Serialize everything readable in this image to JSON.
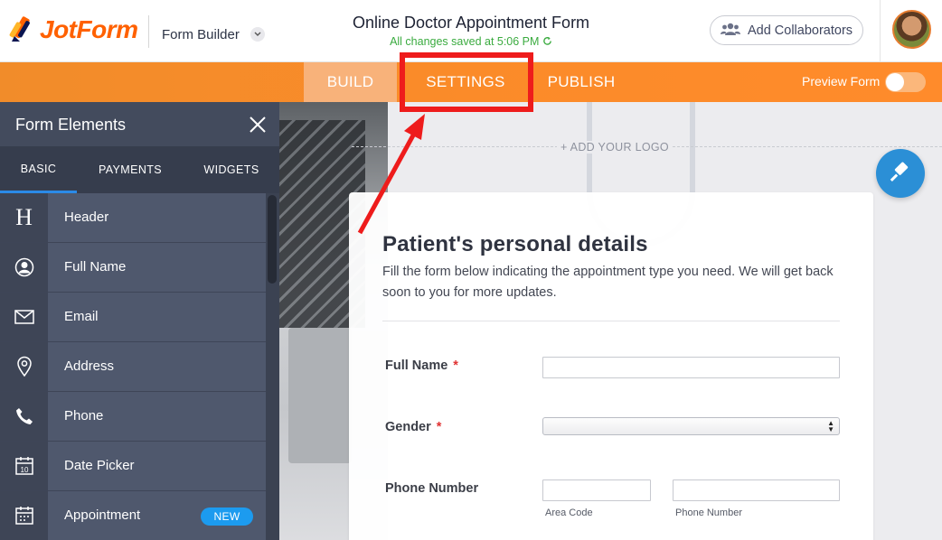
{
  "header": {
    "logo_text": "JotForm",
    "builder_label": "Form Builder",
    "form_title": "Online Doctor Appointment Form",
    "saved_status": "All changes saved at 5:06 PM",
    "collaborators_button": "Add Collaborators"
  },
  "nav": {
    "tabs": [
      "BUILD",
      "SETTINGS",
      "PUBLISH"
    ],
    "active_tab": "BUILD",
    "highlighted_tab": "SETTINGS",
    "preview_label": "Preview Form",
    "preview_toggle_on": false
  },
  "sidebar": {
    "title": "Form Elements",
    "tabs": [
      "BASIC",
      "PAYMENTS",
      "WIDGETS"
    ],
    "active_tab": "BASIC",
    "items": [
      {
        "label": "Header",
        "icon": "header-icon"
      },
      {
        "label": "Full Name",
        "icon": "user-icon"
      },
      {
        "label": "Email",
        "icon": "envelope-icon"
      },
      {
        "label": "Address",
        "icon": "map-pin-icon"
      },
      {
        "label": "Phone",
        "icon": "phone-icon"
      },
      {
        "label": "Date Picker",
        "icon": "calendar-icon"
      },
      {
        "label": "Appointment",
        "icon": "appointment-calendar-icon",
        "badge": "NEW"
      }
    ]
  },
  "canvas": {
    "add_logo": "+ ADD YOUR LOGO",
    "form": {
      "heading": "Patient's personal details",
      "description": "Fill the form below indicating the appointment type you need. We will get back soon to you for more updates.",
      "fields": {
        "full_name": {
          "label": "Full Name",
          "required_mark": "*"
        },
        "gender": {
          "label": "Gender",
          "required_mark": "*"
        },
        "phone_number": {
          "label": "Phone Number",
          "area_code_sublabel": "Area Code",
          "phone_sublabel": "Phone Number"
        }
      }
    }
  },
  "colors": {
    "brand_orange": "#ff6100",
    "nav_orange": "#fb8b29",
    "sidebar_bg": "#4c5468",
    "accent_blue": "#2b8ae7",
    "annotation_red": "#ee1c1c",
    "saved_green": "#3aab3f"
  }
}
